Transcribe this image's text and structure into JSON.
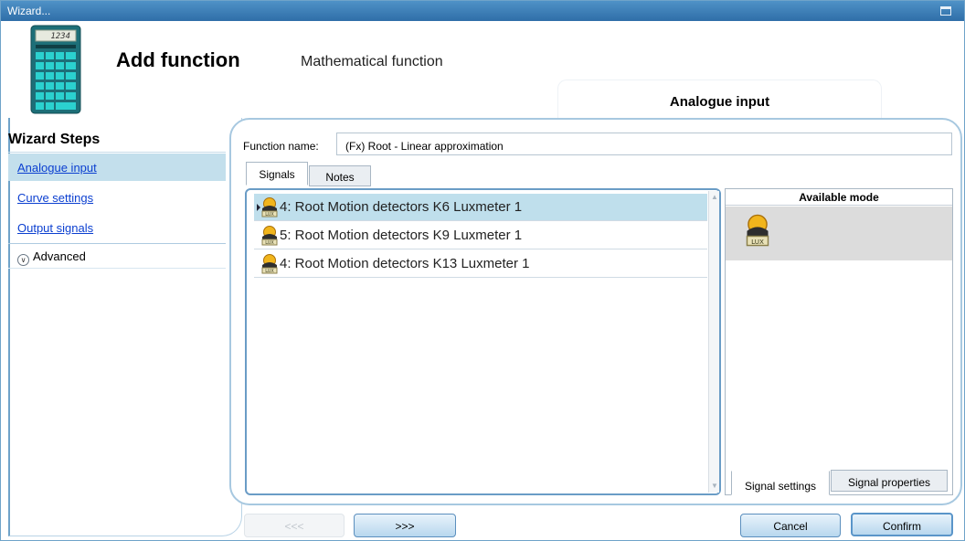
{
  "window": {
    "title": "Wizard..."
  },
  "header": {
    "calculator_display": "1234",
    "title": "Add function",
    "subtitle": "Mathematical function",
    "current_step": "Analogue input"
  },
  "sidebar": {
    "title": "Wizard Steps",
    "items": [
      {
        "label": "Analogue input",
        "active": true
      },
      {
        "label": "Curve settings",
        "active": false
      },
      {
        "label": "Output signals",
        "active": false
      }
    ],
    "advanced_label": "Advanced"
  },
  "form": {
    "function_name_label": "Function name:",
    "function_name_value": "(Fx) Root - Linear approximation"
  },
  "tabs": [
    {
      "label": "Signals",
      "active": true
    },
    {
      "label": "Notes",
      "active": false
    }
  ],
  "signals": [
    {
      "label": "4: Root Motion detectors K6 Luxmeter 1",
      "selected": true,
      "icon": "luxmeter-icon"
    },
    {
      "label": "5: Root Motion detectors K9 Luxmeter 1",
      "selected": false,
      "icon": "luxmeter-icon"
    },
    {
      "label": "4: Root Motion detectors K13 Luxmeter 1",
      "selected": false,
      "icon": "luxmeter-icon"
    }
  ],
  "available_mode": {
    "title": "Available mode",
    "modes": [
      {
        "icon": "luxmeter-icon"
      }
    ],
    "bottom_tabs": [
      {
        "label": "Signal settings",
        "active": true
      },
      {
        "label": "Signal properties",
        "active": false
      }
    ]
  },
  "icon_lux_text": "LUX",
  "buttons": {
    "back": "<<<",
    "next": ">>>",
    "cancel": "Cancel",
    "confirm": "Confirm"
  },
  "colors": {
    "titlebar": "#2f6ea8",
    "selected_row": "#bfdfec",
    "link": "#0b3fd0"
  }
}
